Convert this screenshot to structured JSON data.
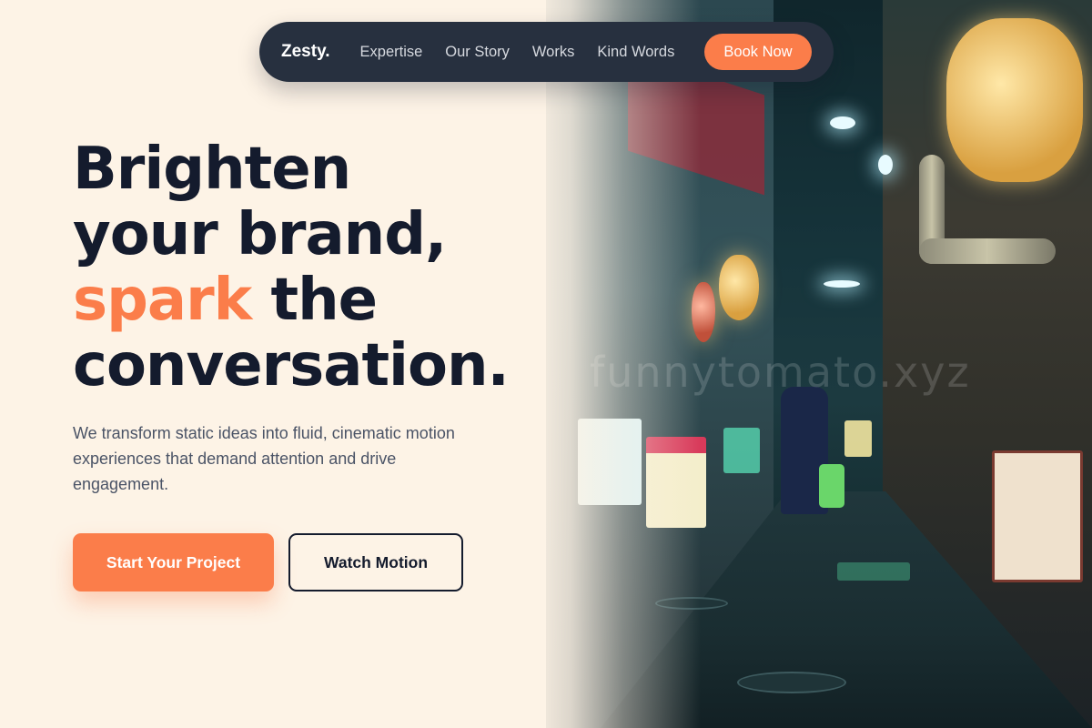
{
  "nav": {
    "brand": "Zesty.",
    "links": [
      "Expertise",
      "Our Story",
      "Works",
      "Kind Words"
    ],
    "cta": "Book Now"
  },
  "hero": {
    "headline_line1": "Brighten",
    "headline_line2": "your brand,",
    "headline_accent": "spark",
    "headline_line3_rest": " the",
    "headline_line4": "conversation.",
    "subtext": "We transform static ideas into fluid, cinematic motion experiences that demand attention and drive engagement.",
    "primary_button": "Start Your Project",
    "secondary_button": "Watch Motion"
  },
  "image": {
    "watermark": "funnytomato.xyz"
  },
  "colors": {
    "background": "#fdf3e6",
    "nav_background": "#27303f",
    "accent": "#fb7d4a",
    "heading": "#141b2d",
    "body_text": "#4a5366"
  }
}
